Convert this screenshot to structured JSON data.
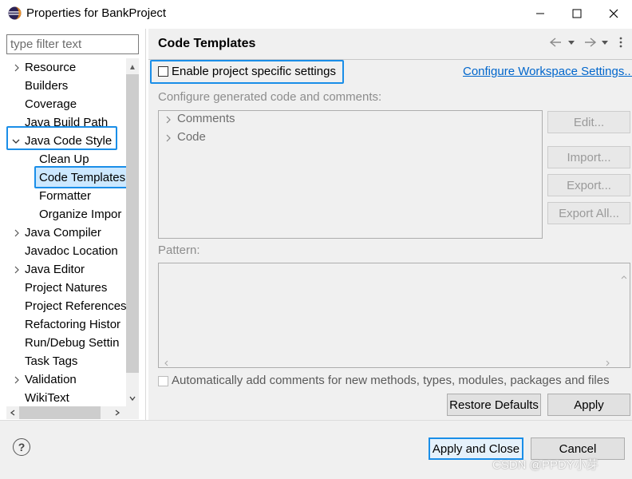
{
  "window": {
    "title": "Properties for BankProject"
  },
  "filter": {
    "placeholder": "type filter text"
  },
  "tree": {
    "resource": "Resource",
    "builders": "Builders",
    "coverage": "Coverage",
    "java_build_path": "Java Build Path",
    "java_code_style": "Java Code Style",
    "clean_up": "Clean Up",
    "code_templates": "Code Templates",
    "formatter": "Formatter",
    "organize_imports": "Organize Impor",
    "java_compiler": "Java Compiler",
    "javadoc_location": "Javadoc Location",
    "java_editor": "Java Editor",
    "project_natures": "Project Natures",
    "project_references": "Project References",
    "refactoring_history": "Refactoring Histor",
    "run_debug_settings": "Run/Debug Settin",
    "task_tags": "Task Tags",
    "validation": "Validation",
    "wikitext": "WikiText"
  },
  "page": {
    "title": "Code Templates",
    "enable_label": "Enable project specific settings",
    "configure_link": "Configure Workspace Settings...",
    "configure_label": "Configure generated code and comments:",
    "template_tree": {
      "comments": "Comments",
      "code": "Code"
    },
    "edit": "Edit...",
    "import": "Import...",
    "export": "Export...",
    "export_all": "Export All...",
    "pattern_label": "Pattern:",
    "auto_comments": "Automatically add comments for new methods, types, modules, packages and files",
    "restore_defaults": "Restore Defaults",
    "apply": "Apply"
  },
  "footer": {
    "help": "?",
    "apply_close": "Apply and Close",
    "cancel": "Cancel",
    "watermark": "CSDN @PPDY小芽"
  }
}
